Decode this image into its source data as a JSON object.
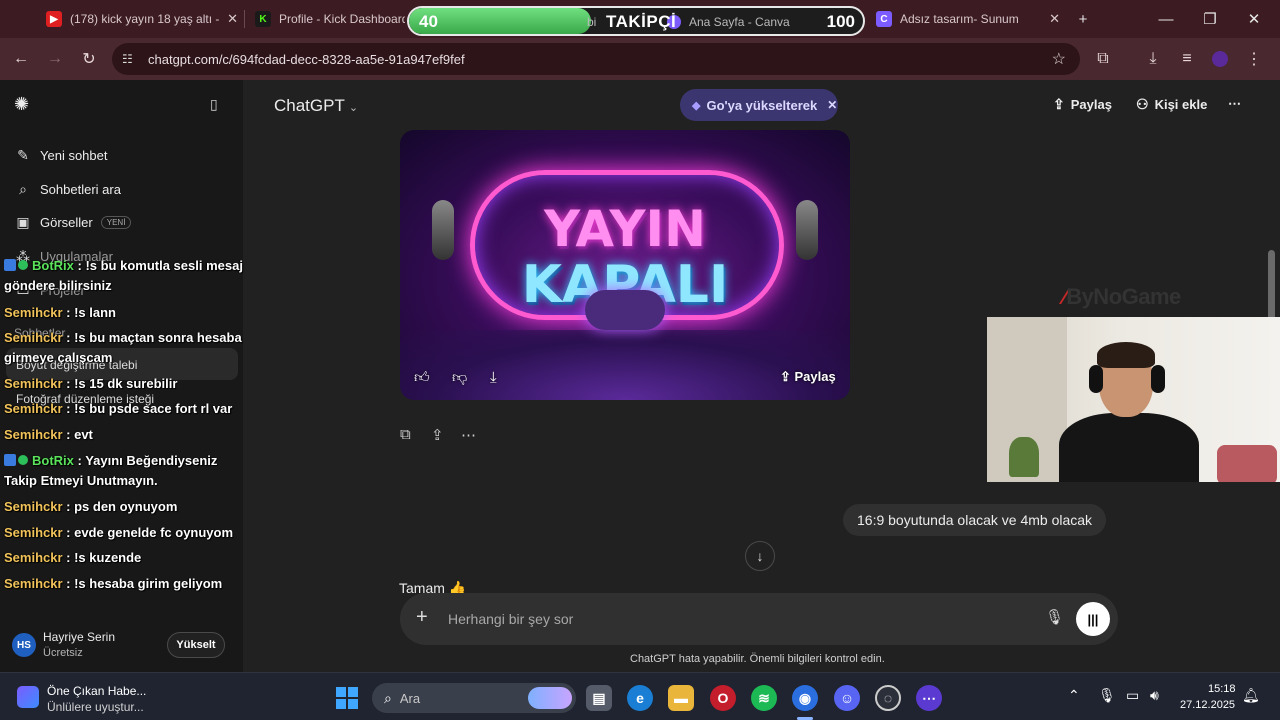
{
  "browser": {
    "tabs": [
      {
        "title": "(178) kick yayın 18 yaş altı -",
        "icon": "youtube-icon"
      },
      {
        "title": "Profile - Kick Dashboard",
        "icon": "kick-icon"
      },
      {
        "title": "bi",
        "icon": "chatgpt-icon"
      },
      {
        "title": "Ana Sayfa - Canva",
        "icon": "canva-icon"
      },
      {
        "title": "Adsız tasarım- Sunum",
        "icon": "canva-icon"
      }
    ],
    "new_tab": "+",
    "url": "chatgpt.com/c/694fcdad-decc-8328-aa5e-91a947ef9fef"
  },
  "overlay": {
    "follow_goal": {
      "start": "40",
      "label": "TAKİPÇİ",
      "end": "100",
      "progress": 0.4
    },
    "chat": [
      {
        "user": "BotRix",
        "bot": true,
        "text": " : !s bu komutla sesli mesaj göndere bilirsiniz"
      },
      {
        "user": "Semihckr",
        "bot": false,
        "text": " : !s lann"
      },
      {
        "user": "Semihckr",
        "bot": false,
        "text": " : !s bu maçtan sonra hesaba girmeye çalışcam"
      },
      {
        "user": "Semihckr",
        "bot": false,
        "text": " : !s 15 dk surebilir"
      },
      {
        "user": "Semihckr",
        "bot": false,
        "text": " : !s bu psde sace fort rl var"
      },
      {
        "user": "Semihckr",
        "bot": false,
        "text": " : evt"
      },
      {
        "user": "BotRix",
        "bot": true,
        "text": " : Yayını Beğendiyseniz Takip Etmeyi Unutmayın."
      },
      {
        "user": "Semihckr",
        "bot": false,
        "text": " : ps den oynuyom"
      },
      {
        "user": "Semihckr",
        "bot": false,
        "text": " : evde genelde fc oynuyom"
      },
      {
        "user": "Semihckr",
        "bot": false,
        "text": " : !s kuzende"
      },
      {
        "user": "Semihckr",
        "bot": false,
        "text": " : !s hesaba girim geliyom"
      }
    ],
    "watermark": "ByNoGame"
  },
  "sidebar": {
    "new_chat": "Yeni sohbet",
    "search_chats": "Sohbetleri ara",
    "images": "Görseller",
    "images_badge": "YENİ",
    "apps": "Uygulamalar",
    "projects": "Projeler",
    "chats_heading": "Sohbetler",
    "recent": [
      "Boyut değiştirme talebi",
      "Fotoğraf düzenleme isteği"
    ],
    "user": {
      "initials": "HS",
      "name": "Hayriye Serin",
      "plan": "Ücretsiz",
      "upgrade": "Yükselt"
    }
  },
  "header": {
    "model": "ChatGPT",
    "upsell": "Go'ya yükselterek",
    "share": "Paylaş",
    "add_people": "Kişi ekle"
  },
  "conversation": {
    "image": {
      "line1": "YAYIN",
      "line2": "KAPALI",
      "share": "Paylaş"
    },
    "user_message": "16:9 boyutunda olacak ve 4mb olacak",
    "assistant_reply": "Tamam 👍"
  },
  "composer": {
    "placeholder": "Herhangi bir şey sor",
    "disclaimer": "ChatGPT hata yapabilir. Önemli bilgileri kontrol edin."
  },
  "taskbar": {
    "news_title": "Öne Çıkan Habe...",
    "news_sub": "Ünlülere uyuştur...",
    "search_placeholder": "Ara",
    "time": "15:18",
    "date": "27.12.2025"
  }
}
